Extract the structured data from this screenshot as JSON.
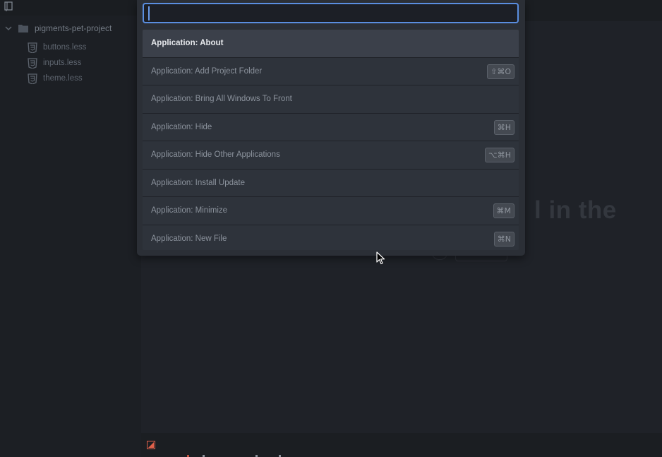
{
  "sidebar": {
    "project_name": "pigments-pet-project",
    "files": [
      {
        "label": "buttons.less",
        "icon": "css3-icon"
      },
      {
        "label": "inputs.less",
        "icon": "css3-icon"
      },
      {
        "label": "theme.less",
        "icon": "css3-icon"
      }
    ]
  },
  "editor": {
    "background_fragment": "l in the"
  },
  "command_palette": {
    "query": "",
    "placeholder": "",
    "items": [
      {
        "label": "Application: About",
        "keybinding": "",
        "selected": true
      },
      {
        "label": "Application: Add Project Folder",
        "keybinding": "⇧⌘O"
      },
      {
        "label": "Application: Bring All Windows To Front",
        "keybinding": ""
      },
      {
        "label": "Application: Hide",
        "keybinding": "⌘H"
      },
      {
        "label": "Application: Hide Other Applications",
        "keybinding": "⌥⌘H"
      },
      {
        "label": "Application: Install Update",
        "keybinding": ""
      },
      {
        "label": "Application: Minimize",
        "keybinding": "⌘M"
      },
      {
        "label": "Application: New File",
        "keybinding": "⌘N"
      }
    ]
  },
  "colors": {
    "accent": "#5a8ee0",
    "background": "#1c1f24",
    "panel": "#2b2f36",
    "status_icon": "#e0604a"
  }
}
